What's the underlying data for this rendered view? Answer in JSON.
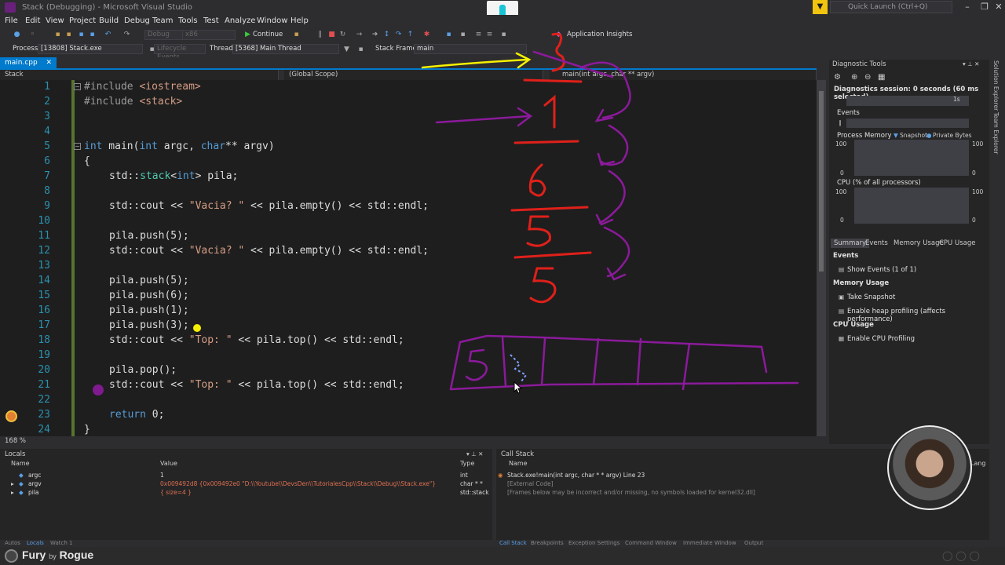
{
  "window": {
    "title": "Stack (Debugging) - Microsoft Visual Studio",
    "quick_launch": "Quick Launch (Ctrl+Q)"
  },
  "menu": [
    "File",
    "Edit",
    "View",
    "Project",
    "Build",
    "Debug",
    "Team",
    "Tools",
    "Test",
    "Analyze",
    "Window",
    "Help"
  ],
  "toolbar": {
    "config": "Debug",
    "platform": "x86",
    "continue_label": "Continue",
    "app_insights": "Application Insights",
    "process_label": "Process:",
    "process_value": "[13808] Stack.exe",
    "lifecycle": "Lifecycle Events",
    "thread_label": "Thread:",
    "thread_value": "[5368] Main Thread",
    "stack_frame_label": "Stack Frame:",
    "stack_frame_value": "main"
  },
  "tab": {
    "name": "main.cpp"
  },
  "nav": {
    "project": "Stack",
    "scope": "(Global Scope)",
    "function": "main(int argc, char ** argv)"
  },
  "zoom": "168 %",
  "code": {
    "line_numbers": [
      "1",
      "2",
      "3",
      "4",
      "5",
      "6",
      "7",
      "8",
      "9",
      "10",
      "11",
      "12",
      "13",
      "14",
      "15",
      "16",
      "17",
      "18",
      "19",
      "20",
      "21",
      "22",
      "23",
      "24"
    ],
    "l1a": "#include ",
    "l1b": "<iostream>",
    "l2a": "#include ",
    "l2b": "<stack>",
    "l5a": "int",
    "l5b": " main(",
    "l5c": "int",
    "l5d": " argc, ",
    "l5e": "char",
    "l5f": "** argv)",
    "l6": "{",
    "l7a": "std::",
    "l7b": "stack",
    "l7c": "<",
    "l7d": "int",
    "l7e": "> pila;",
    "l9a": "std::cout << ",
    "l9b": "\"Vacia? \"",
    "l9c": " << pila.empty() << std::endl;",
    "l11": "pila.push(5);",
    "l12a": "std::cout << ",
    "l12b": "\"Vacia? \"",
    "l12c": " << pila.empty() << std::endl;",
    "l14": "pila.push(5);",
    "l15": "pila.push(6);",
    "l16": "pila.push(1);",
    "l17": "pila.push(3);",
    "l18a": "std::cout << ",
    "l18b": "\"Top: \"",
    "l18c": " << pila.top() << std::endl;",
    "l20": "pila.pop();",
    "l21a": "std::cout << ",
    "l21b": "\"Top: \"",
    "l21c": " << pila.top() << std::endl;",
    "l23a": "return",
    "l23b": " 0;",
    "l24": "}"
  },
  "diagnostics": {
    "title": "Diagnostic Tools",
    "session": "Diagnostics session: 0 seconds (60 ms selected)",
    "time_tick": "1s",
    "events_label": "Events",
    "process_memory": "Process Memory",
    "snapshot_legend": "Snapshot",
    "private_bytes_legend": "Private Bytes",
    "cpu_label": "CPU (% of all processors)",
    "axis_max": "100",
    "axis_min": "0",
    "tabs": [
      "Summary",
      "Events",
      "Memory Usage",
      "CPU Usage"
    ],
    "sec_events": "Events",
    "show_events": "Show Events (1 of 1)",
    "sec_memory": "Memory Usage",
    "take_snapshot": "Take Snapshot",
    "heap_profiling": "Enable heap profiling (affects performance)",
    "sec_cpu": "CPU Usage",
    "cpu_profiling": "Enable CPU Profiling"
  },
  "side_tabs": [
    "Solution Explorer",
    "Team Explorer"
  ],
  "locals": {
    "title": "Locals",
    "headers": [
      "Name",
      "Value",
      "Type"
    ],
    "rows": [
      {
        "name": "argc",
        "value": "1",
        "type": "int"
      },
      {
        "name": "argv",
        "value": "0x009492d8 {0x009492e0 \"D:\\\\Youtube\\\\DevsDen\\\\TutorialesCpp\\\\Stack\\\\Debug\\\\Stack.exe\"}",
        "type": "char * *"
      },
      {
        "name": "pila",
        "value": "{ size=4 }",
        "type": "std::stack"
      }
    ]
  },
  "callstack": {
    "title": "Call Stack",
    "header": "Name",
    "header_lang": "Lang",
    "rows": [
      "Stack.exe!main(int argc, char * * argv) Line 23",
      "[External Code]",
      "[Frames below may be incorrect and/or missing, no symbols loaded for kernel32.dll]"
    ]
  },
  "bottom_tabs_left": [
    "Autos",
    "Locals",
    "Watch 1"
  ],
  "bottom_tabs_right": [
    "Call Stack",
    "Breakpoints",
    "Exception Settings",
    "Command Window",
    "Immediate Window",
    "Output"
  ],
  "brand": {
    "name": "Fury",
    "by": "by",
    "studio": "Rogue"
  },
  "colors": {
    "accent": "#007acc",
    "background": "#1e1e1e",
    "annotation_red": "#e0201a",
    "annotation_purple": "#8b1a9b",
    "annotation_yellow": "#f5f000"
  }
}
